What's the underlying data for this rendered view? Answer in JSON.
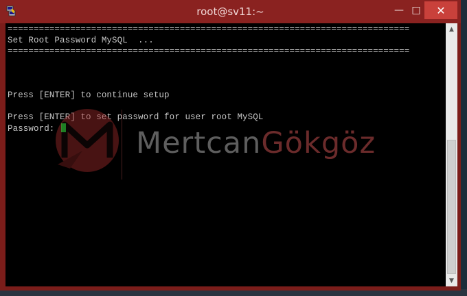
{
  "window": {
    "title": "root@sv11:~",
    "icons": {
      "app": "putty-icon",
      "minimize": "minimize-icon",
      "maximize": "maximize-icon",
      "close": "close-icon"
    },
    "glyphs": {
      "minimize": "—",
      "maximize": "□",
      "close": "✕"
    },
    "accent_color": "#8a2220",
    "close_color": "#c9413b"
  },
  "terminal": {
    "lines": [
      "=============================================================================",
      "Set Root Password MySQL  ...",
      "=============================================================================",
      "Press [ENTER] to continue setup",
      "Press [ENTER] to set password for user root MySQL",
      "Password: "
    ],
    "cursor_color": "#22e03a"
  },
  "watermark": {
    "first": "Mertcan",
    "last": "Gökgöz"
  },
  "scrollbar": {
    "up_glyph": "▲",
    "down_glyph": "▼"
  }
}
